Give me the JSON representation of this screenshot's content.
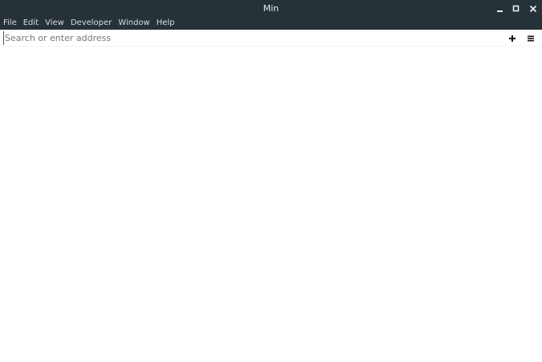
{
  "window": {
    "title": "Min",
    "controls": [
      {
        "name": "minimize",
        "icon": "minimize-icon"
      },
      {
        "name": "maximize",
        "icon": "maximize-icon"
      },
      {
        "name": "close",
        "icon": "close-icon"
      }
    ]
  },
  "menubar": {
    "items": [
      "File",
      "Edit",
      "View",
      "Developer",
      "Window",
      "Help"
    ]
  },
  "navbar": {
    "address_value": "",
    "address_placeholder": "Search or enter address",
    "new_tab_icon": "plus-icon",
    "menu_icon": "hamburger-menu-icon"
  },
  "colors": {
    "titlebar_bg": "#263238",
    "titlebar_text": "#e8ecee",
    "content_bg": "#ffffff"
  }
}
